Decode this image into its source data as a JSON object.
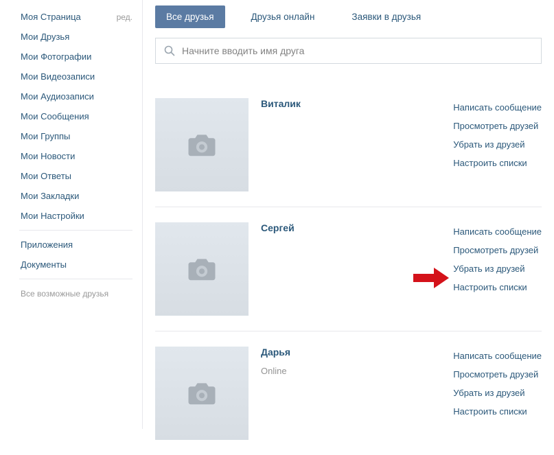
{
  "sidebar": {
    "items": [
      {
        "label": "Моя Страница",
        "edit": "ред."
      },
      {
        "label": "Мои Друзья"
      },
      {
        "label": "Мои Фотографии"
      },
      {
        "label": "Мои Видеозаписи"
      },
      {
        "label": "Мои Аудиозаписи"
      },
      {
        "label": "Мои Сообщения"
      },
      {
        "label": "Мои Группы"
      },
      {
        "label": "Мои Новости"
      },
      {
        "label": "Мои Ответы"
      },
      {
        "label": "Мои Закладки"
      },
      {
        "label": "Мои Настройки"
      }
    ],
    "secondary": [
      {
        "label": "Приложения"
      },
      {
        "label": "Документы"
      }
    ],
    "footer": "Все возможные друзья"
  },
  "tabs": [
    {
      "label": "Все друзья",
      "active": true
    },
    {
      "label": "Друзья онлайн",
      "active": false
    },
    {
      "label": "Заявки в друзья",
      "active": false
    }
  ],
  "search": {
    "placeholder": "Начните вводить имя друга"
  },
  "friends": [
    {
      "name": "Виталик",
      "status": "",
      "actions": [
        "Написать сообщение",
        "Просмотреть друзей",
        "Убрать из друзей",
        "Настроить списки"
      ],
      "highlight_arrow": false
    },
    {
      "name": "Сергей",
      "status": "",
      "actions": [
        "Написать сообщение",
        "Просмотреть друзей",
        "Убрать из друзей",
        "Настроить списки"
      ],
      "highlight_arrow": true
    },
    {
      "name": "Дарья",
      "status": "Online",
      "actions": [
        "Написать сообщение",
        "Просмотреть друзей",
        "Убрать из друзей",
        "Настроить списки"
      ],
      "highlight_arrow": false
    }
  ]
}
